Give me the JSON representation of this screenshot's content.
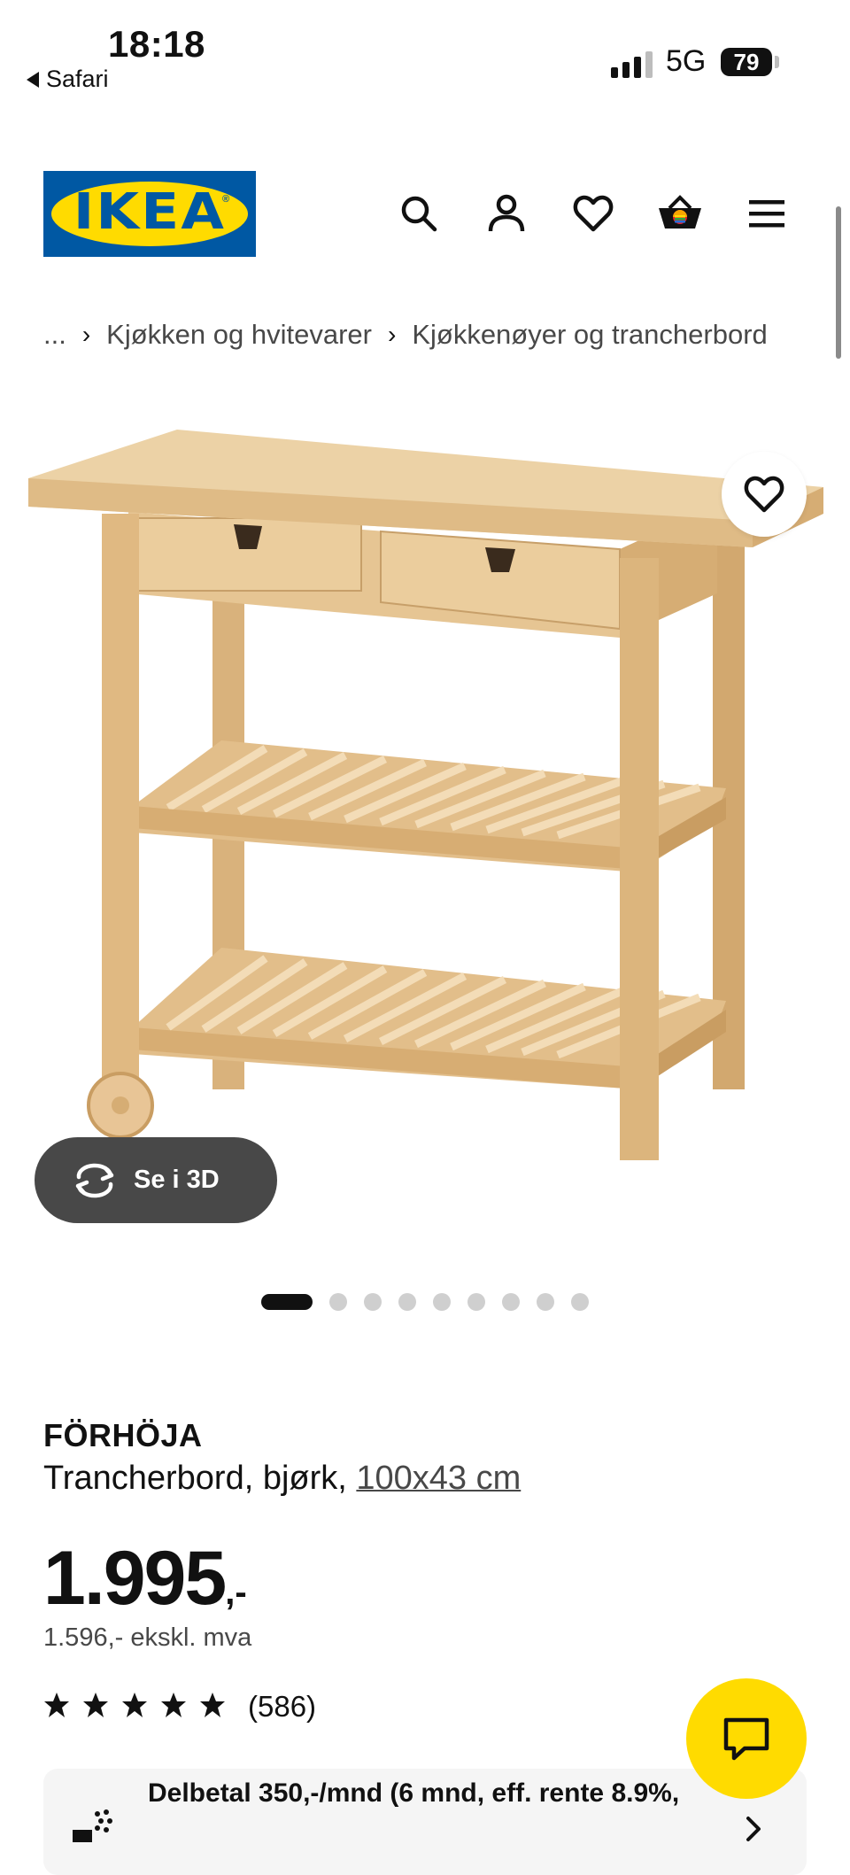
{
  "status_bar": {
    "time": "18:18",
    "back_app": "Safari",
    "network": "5G",
    "battery": "79"
  },
  "header": {
    "logo_text": "IKEA",
    "icons": [
      "search-icon",
      "account-icon",
      "heart-icon",
      "basket-icon",
      "menu-icon"
    ]
  },
  "breadcrumb": {
    "ellipsis": "...",
    "items": [
      "Kjøkken og hvitevarer",
      "Kjøkkenøyer og trancherbord"
    ]
  },
  "gallery": {
    "view_3d_label": "Se i 3D",
    "total_images": 10,
    "active_index": 0
  },
  "product": {
    "name": "FÖRHÖJA",
    "description_prefix": "Trancherbord, bjørk, ",
    "dimensions": "100x43 cm",
    "price_main": "1.995",
    "price_suffix": ",-",
    "price_ex_vat": "1.596,- ekskl. mva",
    "rating_stars": 5,
    "review_count": "(586)"
  },
  "financing": {
    "text": "Delbetal 350,-/mnd (6 mnd, eff. rente 8.9%,"
  },
  "colors": {
    "ikea_blue": "#0058a3",
    "ikea_yellow": "#ffdb00",
    "dark_button": "#484848"
  }
}
